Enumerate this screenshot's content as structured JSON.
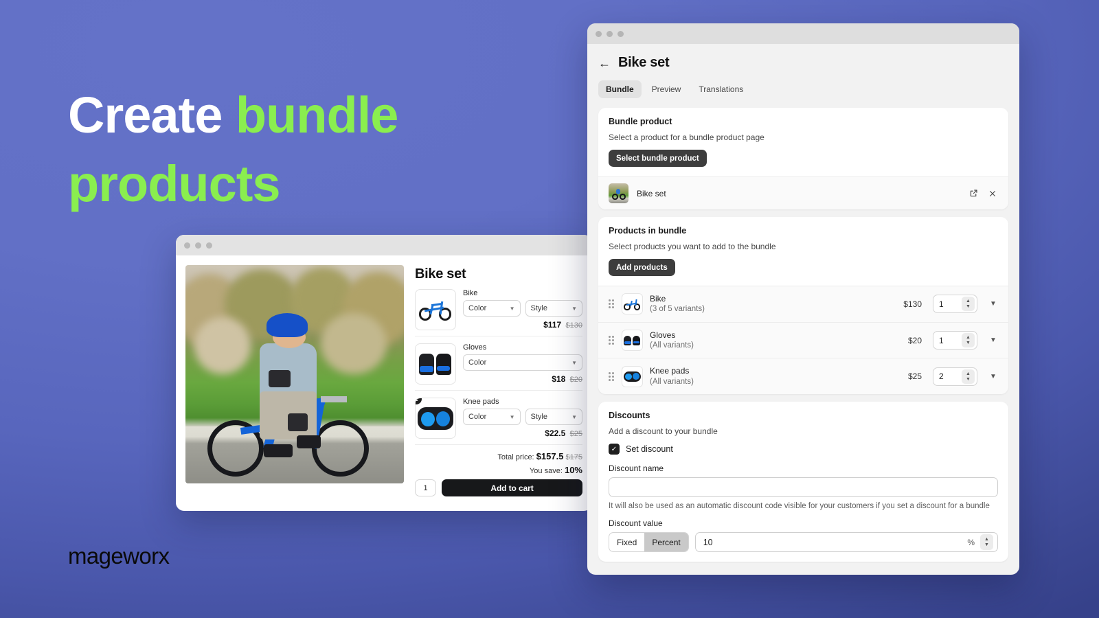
{
  "hero": {
    "line1_white": "Create ",
    "line1_green": "bundle",
    "line2_green": "products",
    "logo": "mageworx",
    "accent_green": "#8aee4f",
    "background": "#5a6bc0"
  },
  "storefront": {
    "title": "Bike set",
    "items": [
      {
        "name": "Bike",
        "selects": [
          "Color",
          "Style"
        ],
        "price": "$117",
        "compare_at": "$130",
        "badge": ""
      },
      {
        "name": "Gloves",
        "selects": [
          "Color"
        ],
        "price": "$18",
        "compare_at": "$20",
        "badge": ""
      },
      {
        "name": "Knee pads",
        "selects": [
          "Color",
          "Style"
        ],
        "price": "$22.5",
        "compare_at": "$25",
        "badge": "2"
      }
    ],
    "total_label": "Total price:",
    "total_price": "$157.5",
    "total_compare_at": "$175",
    "save_label": "You save:",
    "save_value": "10%",
    "quantity": "1",
    "add_to_cart": "Add to cart"
  },
  "admin": {
    "back_arrow": "←",
    "title": "Bike set",
    "tabs": [
      {
        "label": "Bundle",
        "active": true
      },
      {
        "label": "Preview",
        "active": false
      },
      {
        "label": "Translations",
        "active": false
      }
    ],
    "bundle_product": {
      "title": "Bundle product",
      "subtitle": "Select a product for a bundle product page",
      "button": "Select bundle product",
      "selected_name": "Bike set",
      "open_icon": "external-link",
      "remove_icon": "close"
    },
    "products_in_bundle": {
      "title": "Products in bundle",
      "subtitle": "Select products you want to add to the bundle",
      "button": "Add products",
      "rows": [
        {
          "name": "Bike",
          "variants": "(3 of 5 variants)",
          "price": "$130",
          "quantity": "1"
        },
        {
          "name": "Gloves",
          "variants": "(All variants)",
          "price": "$20",
          "quantity": "1"
        },
        {
          "name": "Knee pads",
          "variants": "(All variants)",
          "price": "$25",
          "quantity": "2"
        }
      ]
    },
    "discounts": {
      "title": "Discounts",
      "subtitle": "Add a discount to your bundle",
      "checkbox_label": "Set discount",
      "checkbox_checked": true,
      "name_label": "Discount name",
      "name_value": "",
      "name_placeholder": "",
      "helper": "It will also be used as an automatic discount code visible for your customers if you set a discount for a bundle",
      "value_label": "Discount value",
      "segments": [
        {
          "label": "Fixed",
          "active": false
        },
        {
          "label": "Percent",
          "active": true
        }
      ],
      "value": "10",
      "unit": "%"
    }
  }
}
